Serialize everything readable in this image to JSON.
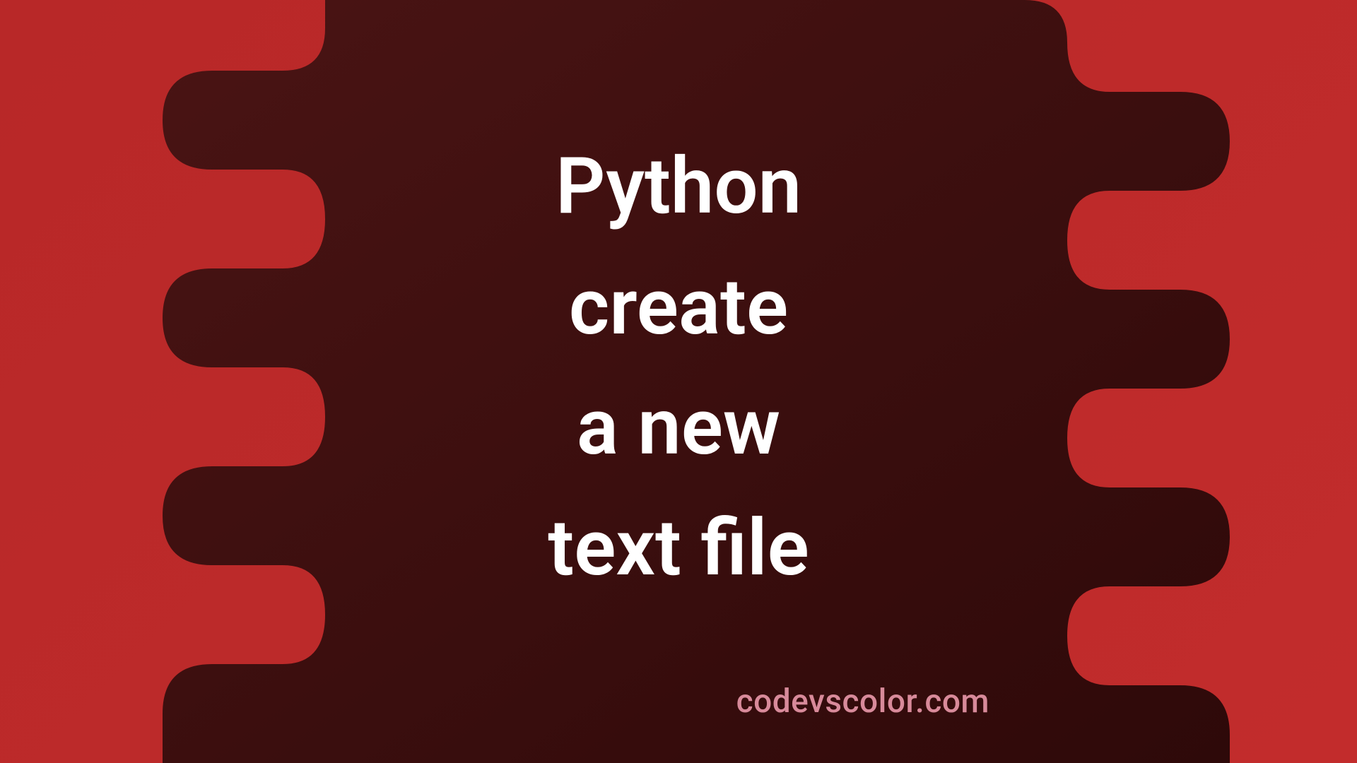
{
  "title": {
    "line1": "Python",
    "line2": "create",
    "line3": "a new",
    "line4": "text file"
  },
  "footer": "codevscolor.com",
  "colors": {
    "bg_outer": "#c22c2c",
    "bg_inner": "#3d0e0e",
    "text_main": "#ffffff",
    "text_footer": "#d88a9a"
  }
}
